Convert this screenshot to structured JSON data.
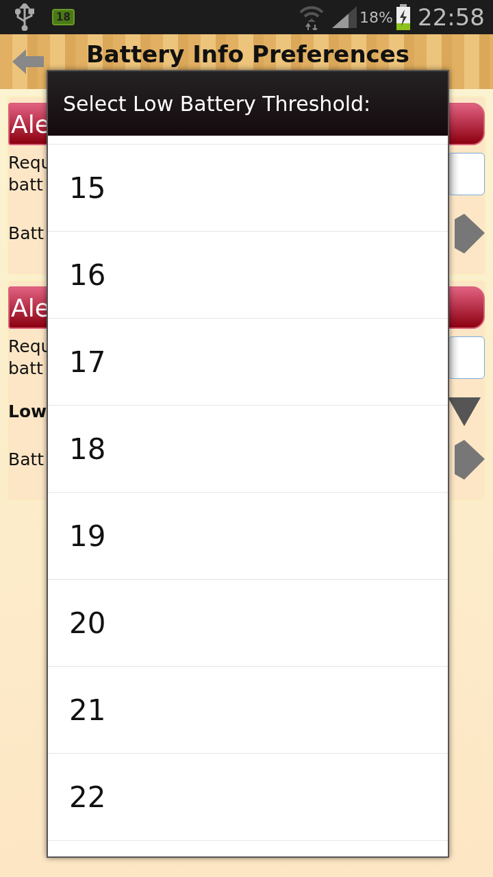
{
  "status_bar": {
    "notification_count": "18",
    "battery_percent": "18%",
    "time": "22:58"
  },
  "header": {
    "title": "Battery Info Preferences"
  },
  "sections": [
    {
      "title": "Ale",
      "rows": [
        {
          "kind": "checkbox",
          "lines": [
            "Requ",
            "batt"
          ],
          "checked": false
        },
        {
          "kind": "picker",
          "lines": [
            "Batt"
          ]
        }
      ]
    },
    {
      "title": "Ale",
      "rows": [
        {
          "kind": "checkbox",
          "lines": [
            "Requ",
            "batt"
          ],
          "checked": false
        },
        {
          "kind": "dropdown",
          "lines": [
            "Low"
          ]
        },
        {
          "kind": "picker",
          "lines": [
            "Batt"
          ]
        }
      ]
    }
  ],
  "dialog": {
    "title": "Select Low Battery Threshold:",
    "options": [
      "15",
      "16",
      "17",
      "18",
      "19",
      "20",
      "21",
      "22"
    ]
  }
}
